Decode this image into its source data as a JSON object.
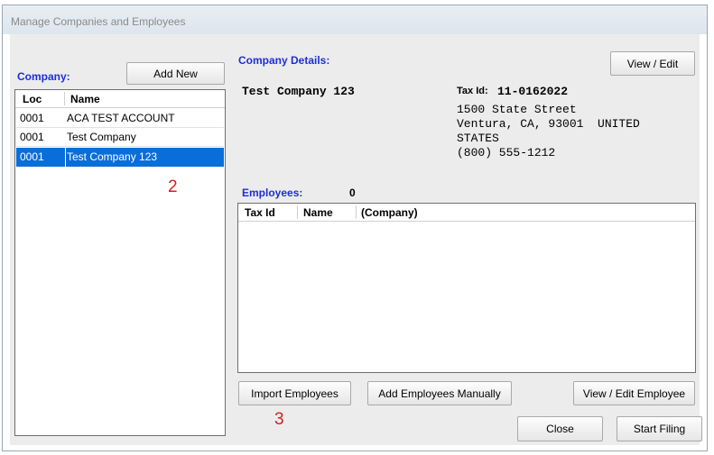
{
  "window": {
    "title": "Manage Companies and Employees"
  },
  "company_panel": {
    "label": "Company:",
    "add_new_label": "Add New",
    "columns": {
      "loc": "Loc",
      "name": "Name"
    },
    "rows": [
      {
        "loc": "0001",
        "name": "ACA TEST ACCOUNT"
      },
      {
        "loc": "0001",
        "name": "Test Company"
      },
      {
        "loc": "0001",
        "name": "Test Company 123",
        "selected": true
      }
    ]
  },
  "details": {
    "label": "Company Details:",
    "view_edit_label": "View / Edit",
    "company_name": "Test Company 123",
    "tax_id_label": "Tax Id:",
    "tax_id_value": "11-0162022",
    "address_line1": "1500 State Street",
    "address_line2": "Ventura, CA, 93001  UNITED",
    "address_line3": "STATES",
    "phone": "(800) 555-1212"
  },
  "employees": {
    "label": "Employees:",
    "count": "0",
    "columns": {
      "tax_id": "Tax Id",
      "name": "Name",
      "company": "(Company)"
    }
  },
  "buttons": {
    "import": "Import Employees",
    "add_manual": "Add Employees Manually",
    "view_edit_employee": "View / Edit Employee",
    "close": "Close",
    "start_filing": "Start Filing"
  },
  "annotations": {
    "two": "2",
    "three": "3"
  }
}
